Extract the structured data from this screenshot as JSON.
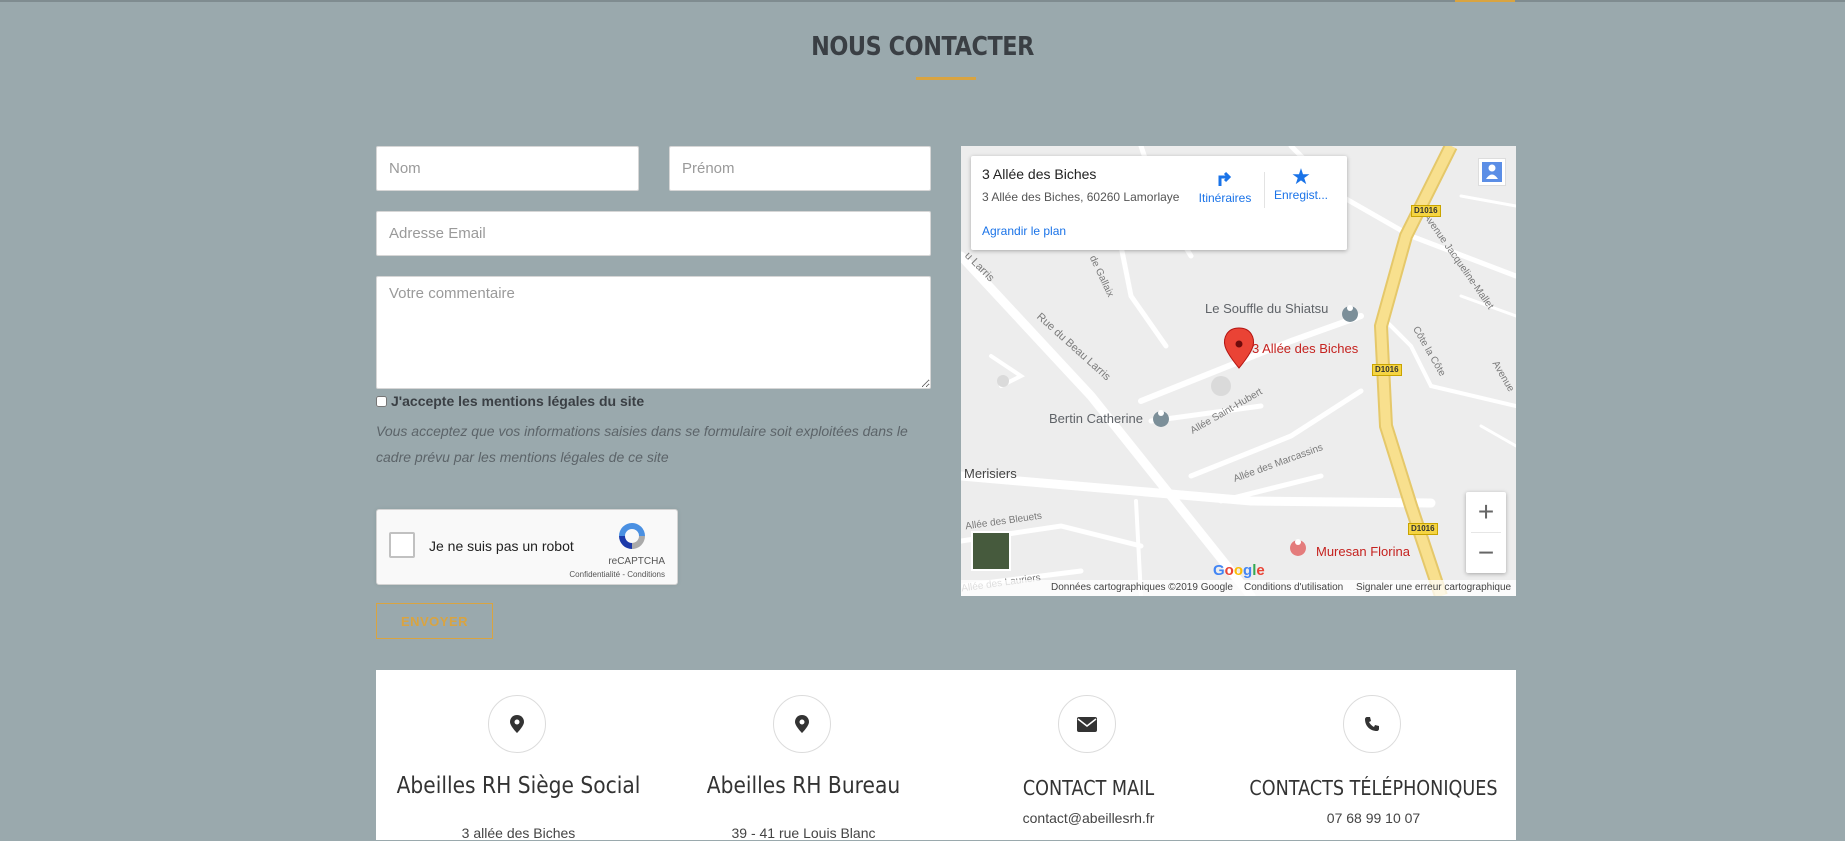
{
  "section": {
    "title": "NOUS CONTACTER"
  },
  "form": {
    "nom_placeholder": "Nom",
    "prenom_placeholder": "Prénom",
    "email_placeholder": "Adresse Email",
    "comment_placeholder": "Votre commentaire",
    "consent_label": "J'accepte les mentions légales du site",
    "disclaimer": "Vous acceptez que vos informations saisies dans se formulaire soit exploitées dans le cadre prévu par les mentions légales de ce site",
    "recaptcha": {
      "label": "Je ne suis pas un robot",
      "brand": "reCAPTCHA",
      "links": "Confidentialité - Conditions"
    },
    "submit_label": "ENVOYER"
  },
  "map": {
    "card": {
      "title": "3 Allée des Biches",
      "address": "3 Allée des Biches, 60260 Lamorlaye",
      "enlarge": "Agrandir le plan",
      "directions": "Itinéraires",
      "save": "Enregist..."
    },
    "places": {
      "shiatsu": "Le Souffle du Shiatsu",
      "marker": "3 Allée des Biches",
      "bertin": "Bertin Catherine",
      "muresan": "Muresan Florina",
      "merisiers": "Merisiers"
    },
    "roads": {
      "beau_larris": "Rue du Beau Larris",
      "larris": "u Larris",
      "gallaix": "de Gallaix",
      "saint_hubert": "Allée Saint-Hubert",
      "marcassins": "Allée des Marcassins",
      "bleuets": "Allée des Bleuets",
      "lauriers": "Allée des Lauriers",
      "jacqueline": "Avenue Jacqueline-Mallet",
      "cote": "Côte la Côte",
      "avenue": "Avenue"
    },
    "route_badge": "D1016",
    "google": "Google",
    "attribution": {
      "data": "Données cartographiques ©2019 Google",
      "terms": "Conditions d'utilisation",
      "report": "Signaler une erreur cartographique"
    },
    "zoom_in": "+",
    "zoom_out": "−",
    "colors": {
      "marker": "#ea4335",
      "route": "#f8e08e",
      "poi": "#7c8f99"
    }
  },
  "contacts": [
    {
      "icon": "map-pin-icon",
      "title": "Abeilles RH Siège Social",
      "line": "3 allée des Biches"
    },
    {
      "icon": "map-pin-icon",
      "title": "Abeilles RH Bureau",
      "line": "39 - 41 rue Louis Blanc"
    },
    {
      "icon": "envelope-icon",
      "title": "CONTACT MAIL",
      "line": "contact@abeillesrh.fr"
    },
    {
      "icon": "phone-icon",
      "title": "CONTACTS TÉLÉPHONIQUES",
      "line": "07 68 99 10 07"
    }
  ],
  "colors": {
    "accent": "#d9a441",
    "background": "#9aa9ad",
    "heading": "#3a3f44"
  }
}
